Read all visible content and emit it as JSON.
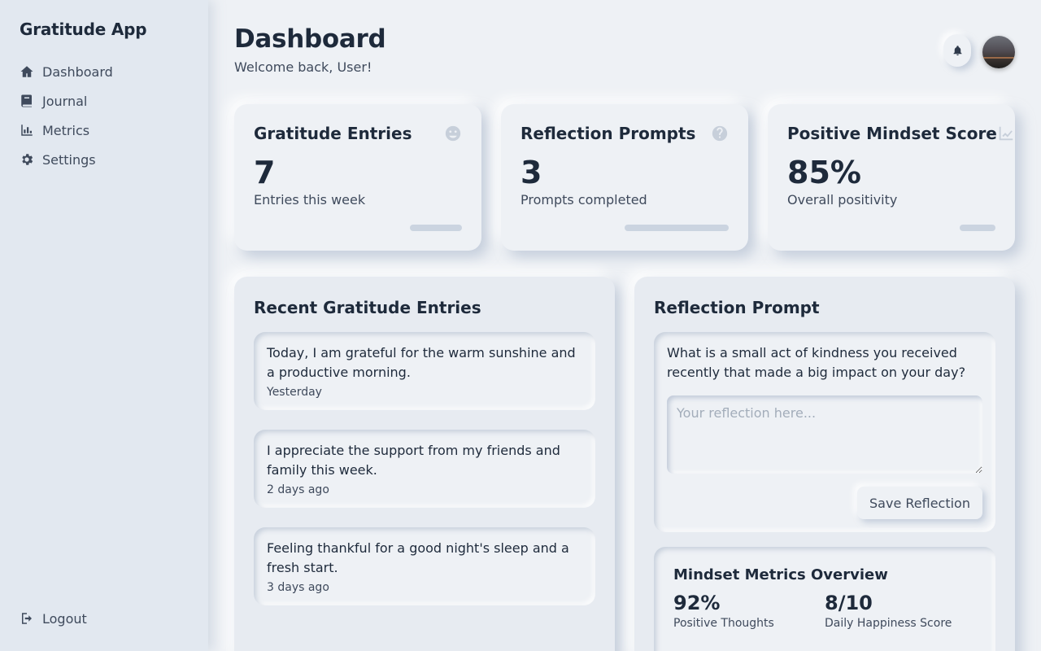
{
  "sidebar": {
    "brand": "Gratitude App",
    "items": [
      {
        "label": "Dashboard",
        "icon": "home-icon"
      },
      {
        "label": "Journal",
        "icon": "book-icon"
      },
      {
        "label": "Metrics",
        "icon": "chart-bar-icon"
      },
      {
        "label": "Settings",
        "icon": "gear-icon"
      }
    ],
    "logout": {
      "label": "Logout",
      "icon": "logout-icon"
    }
  },
  "header": {
    "title": "Dashboard",
    "welcome": "Welcome back, User!",
    "notification_icon": "bell-icon",
    "avatar": "user-avatar"
  },
  "stats": [
    {
      "title": "Gratitude Entries",
      "value": "7",
      "subtitle": "Entries this week",
      "icon": "smile-icon",
      "progress": 0.25
    },
    {
      "title": "Reflection Prompts",
      "value": "3",
      "subtitle": "Prompts completed",
      "icon": "question-icon",
      "progress": 0.5
    },
    {
      "title": "Positive Mindset Score",
      "value": "85%",
      "subtitle": "Overall positivity",
      "icon": "line-chart-icon",
      "progress": 0.17
    }
  ],
  "recent": {
    "title": "Recent Gratitude Entries",
    "entries": [
      {
        "text": "Today, I am grateful for the warm sunshine and a productive morning.",
        "date": "Yesterday"
      },
      {
        "text": "I appreciate the support from my friends and family this week.",
        "date": "2 days ago"
      },
      {
        "text": "Feeling thankful for a good night's sleep and a fresh start.",
        "date": "3 days ago"
      }
    ]
  },
  "prompt": {
    "title": "Reflection Prompt",
    "question": "What is a small act of kindness you received recently that made a big impact on your day?",
    "placeholder": "Your reflection here...",
    "value": "",
    "save_label": "Save Reflection"
  },
  "metrics": {
    "title": "Mindset Metrics Overview",
    "items": [
      {
        "value": "92%",
        "label": "Positive Thoughts"
      },
      {
        "value": "8/10",
        "label": "Daily Happiness Score"
      }
    ]
  },
  "colors": {
    "background": "#eef1f5",
    "sidebar": "#e2e8f0",
    "text": "#1e2a3b",
    "muted": "#3f4a5c",
    "progress": "#cbd4e0"
  }
}
